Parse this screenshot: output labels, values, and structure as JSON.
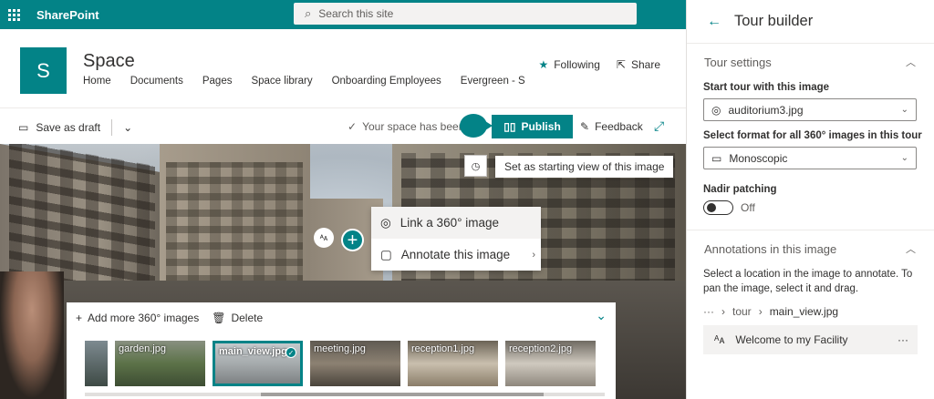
{
  "suite": {
    "brand": "SharePoint",
    "search_placeholder": "Search this site"
  },
  "site": {
    "logo_letter": "S",
    "title": "Space",
    "nav": [
      "Home",
      "Documents",
      "Pages",
      "Space library",
      "Onboarding Employees",
      "Evergreen - Sta"
    ],
    "following": "Following",
    "share": "Share"
  },
  "commandbar": {
    "save_draft": "Save as draft",
    "status": "Your space has been",
    "publish": "Publish",
    "feedback": "Feedback"
  },
  "viewer": {
    "set_start_tooltip": "Set as starting view of this image",
    "annotation_marker_icon": "annotation-icon",
    "context_menu": [
      "Link a 360° image",
      "Annotate this image"
    ]
  },
  "filmstrip": {
    "add_more": "Add more 360° images",
    "delete": "Delete",
    "thumbnails": [
      "",
      "garden.jpg",
      "main_view.jpg",
      "meeting.jpg",
      "reception1.jpg",
      "reception2.jpg"
    ],
    "selected": "main_view.jpg"
  },
  "pane": {
    "title": "Tour builder",
    "settings_header": "Tour settings",
    "start_label": "Start tour with this image",
    "start_value": "auditorium3.jpg",
    "format_label": "Select format for all 360° images in this tour",
    "format_value": "Monoscopic",
    "nadir_label": "Nadir patching",
    "nadir_state": "Off",
    "annotations_header": "Annotations in this image",
    "annotations_help": "Select a location in the image to annotate. To pan the image, select it and drag.",
    "breadcrumb": [
      "···",
      "tour",
      "main_view.jpg"
    ],
    "annotation_item": "Welcome to my Facility",
    "annotation_more": "···"
  },
  "colors": {
    "accent": "#038387"
  }
}
